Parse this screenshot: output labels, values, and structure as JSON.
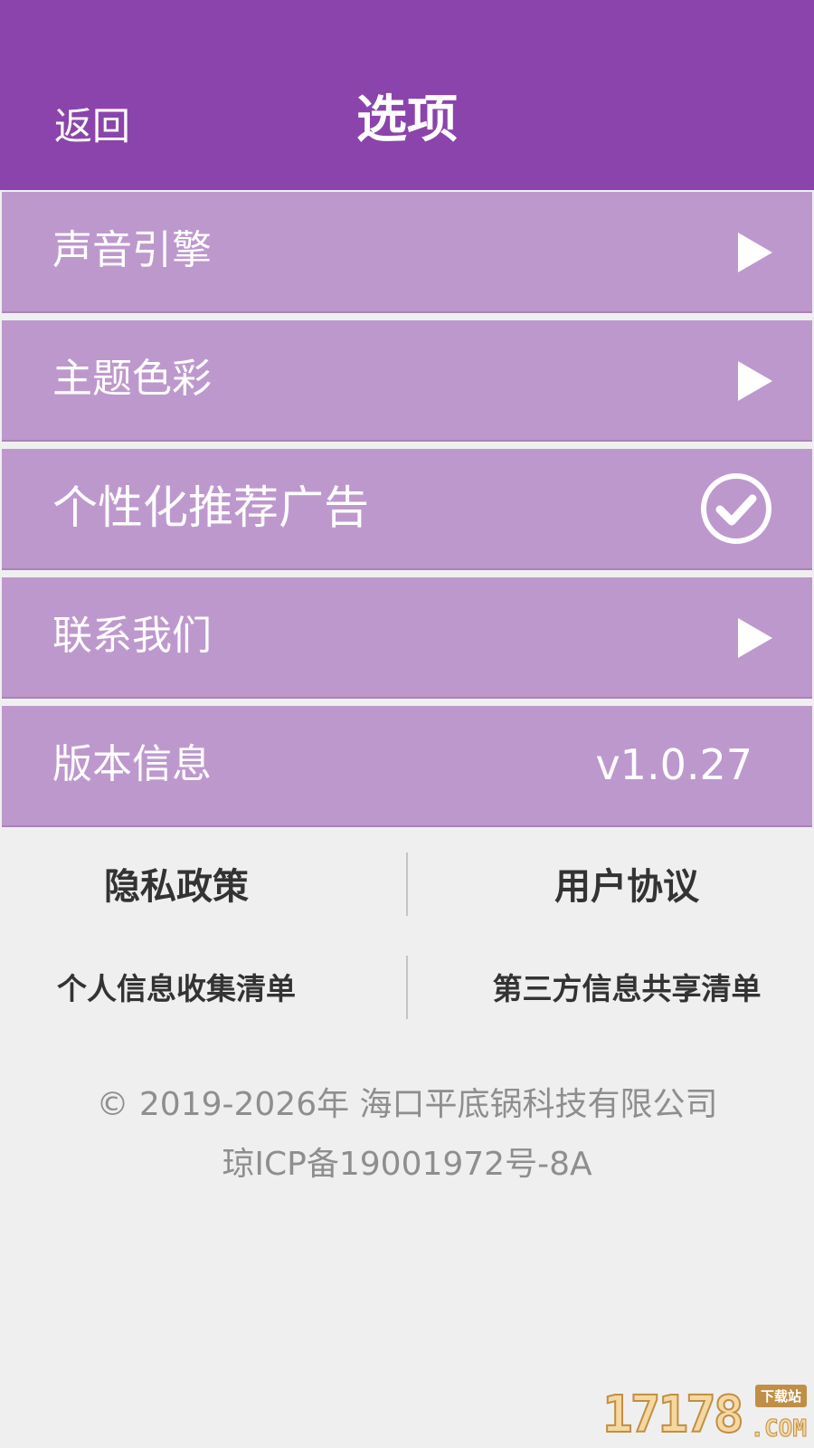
{
  "header": {
    "back_label": "返回",
    "title": "选项"
  },
  "menu": {
    "items": [
      {
        "label": "声音引擎",
        "trailing": "arrow-icon"
      },
      {
        "label": "主题色彩",
        "trailing": "arrow-icon"
      },
      {
        "label": "个性化推荐广告",
        "trailing": "check-circle-icon",
        "checked": true
      },
      {
        "label": "联系我们",
        "trailing": "arrow-icon"
      },
      {
        "label": "版本信息",
        "value": "v1.0.27"
      }
    ]
  },
  "links": {
    "privacy_policy": "隐私政策",
    "user_agreement": "用户协议",
    "personal_info_list": "个人信息收集清单",
    "third_party_list": "第三方信息共享清单"
  },
  "footer": {
    "copyright": "© 2019-2026年 海口平底锅科技有限公司",
    "icp": "琼ICP备19001972号-8A"
  },
  "watermark": {
    "number": "17178",
    "tag": "下载站",
    "suffix": ".COM"
  },
  "colors": {
    "header_bg": "#8b44ac",
    "row_bg": "#bd98cd",
    "page_bg": "#efefef",
    "footer_text": "#8e8e8e"
  }
}
